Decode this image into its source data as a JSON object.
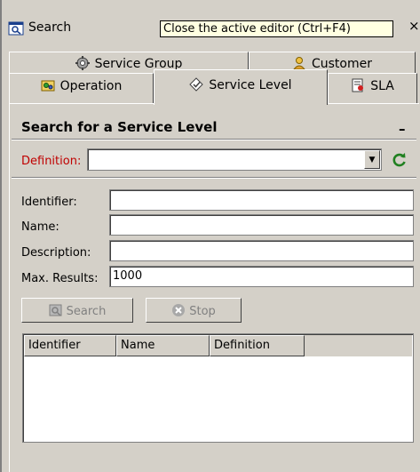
{
  "window": {
    "title": "Search",
    "tooltip": "Close the active editor (Ctrl+F4)",
    "close_glyph": "×"
  },
  "tabs": {
    "row_back": [
      {
        "label": "Service Group",
        "icon": "service-group-icon"
      },
      {
        "label": "Customer",
        "icon": "customer-icon"
      }
    ],
    "row_front": [
      {
        "label": "Operation",
        "icon": "operation-icon"
      },
      {
        "label": "Service Level",
        "icon": "service-level-icon",
        "active": true
      },
      {
        "label": "SLA",
        "icon": "sla-icon"
      }
    ]
  },
  "section": {
    "title": "Search for a Service Level",
    "collapse_glyph": "–"
  },
  "definition": {
    "label": "Definition:",
    "value": "",
    "dropdown_glyph": "▼"
  },
  "fields": [
    {
      "label": "Identifier:",
      "value": ""
    },
    {
      "label": "Name:",
      "value": ""
    },
    {
      "label": "Description:",
      "value": ""
    },
    {
      "label": "Max. Results:",
      "value": "1000"
    }
  ],
  "buttons": {
    "search": "Search",
    "stop": "Stop"
  },
  "table": {
    "columns": [
      "Identifier",
      "Name",
      "Definition"
    ],
    "rows": []
  },
  "colors": {
    "background": "#d4d0c8",
    "required_label": "#c00000",
    "tooltip_bg": "#ffffe1"
  }
}
